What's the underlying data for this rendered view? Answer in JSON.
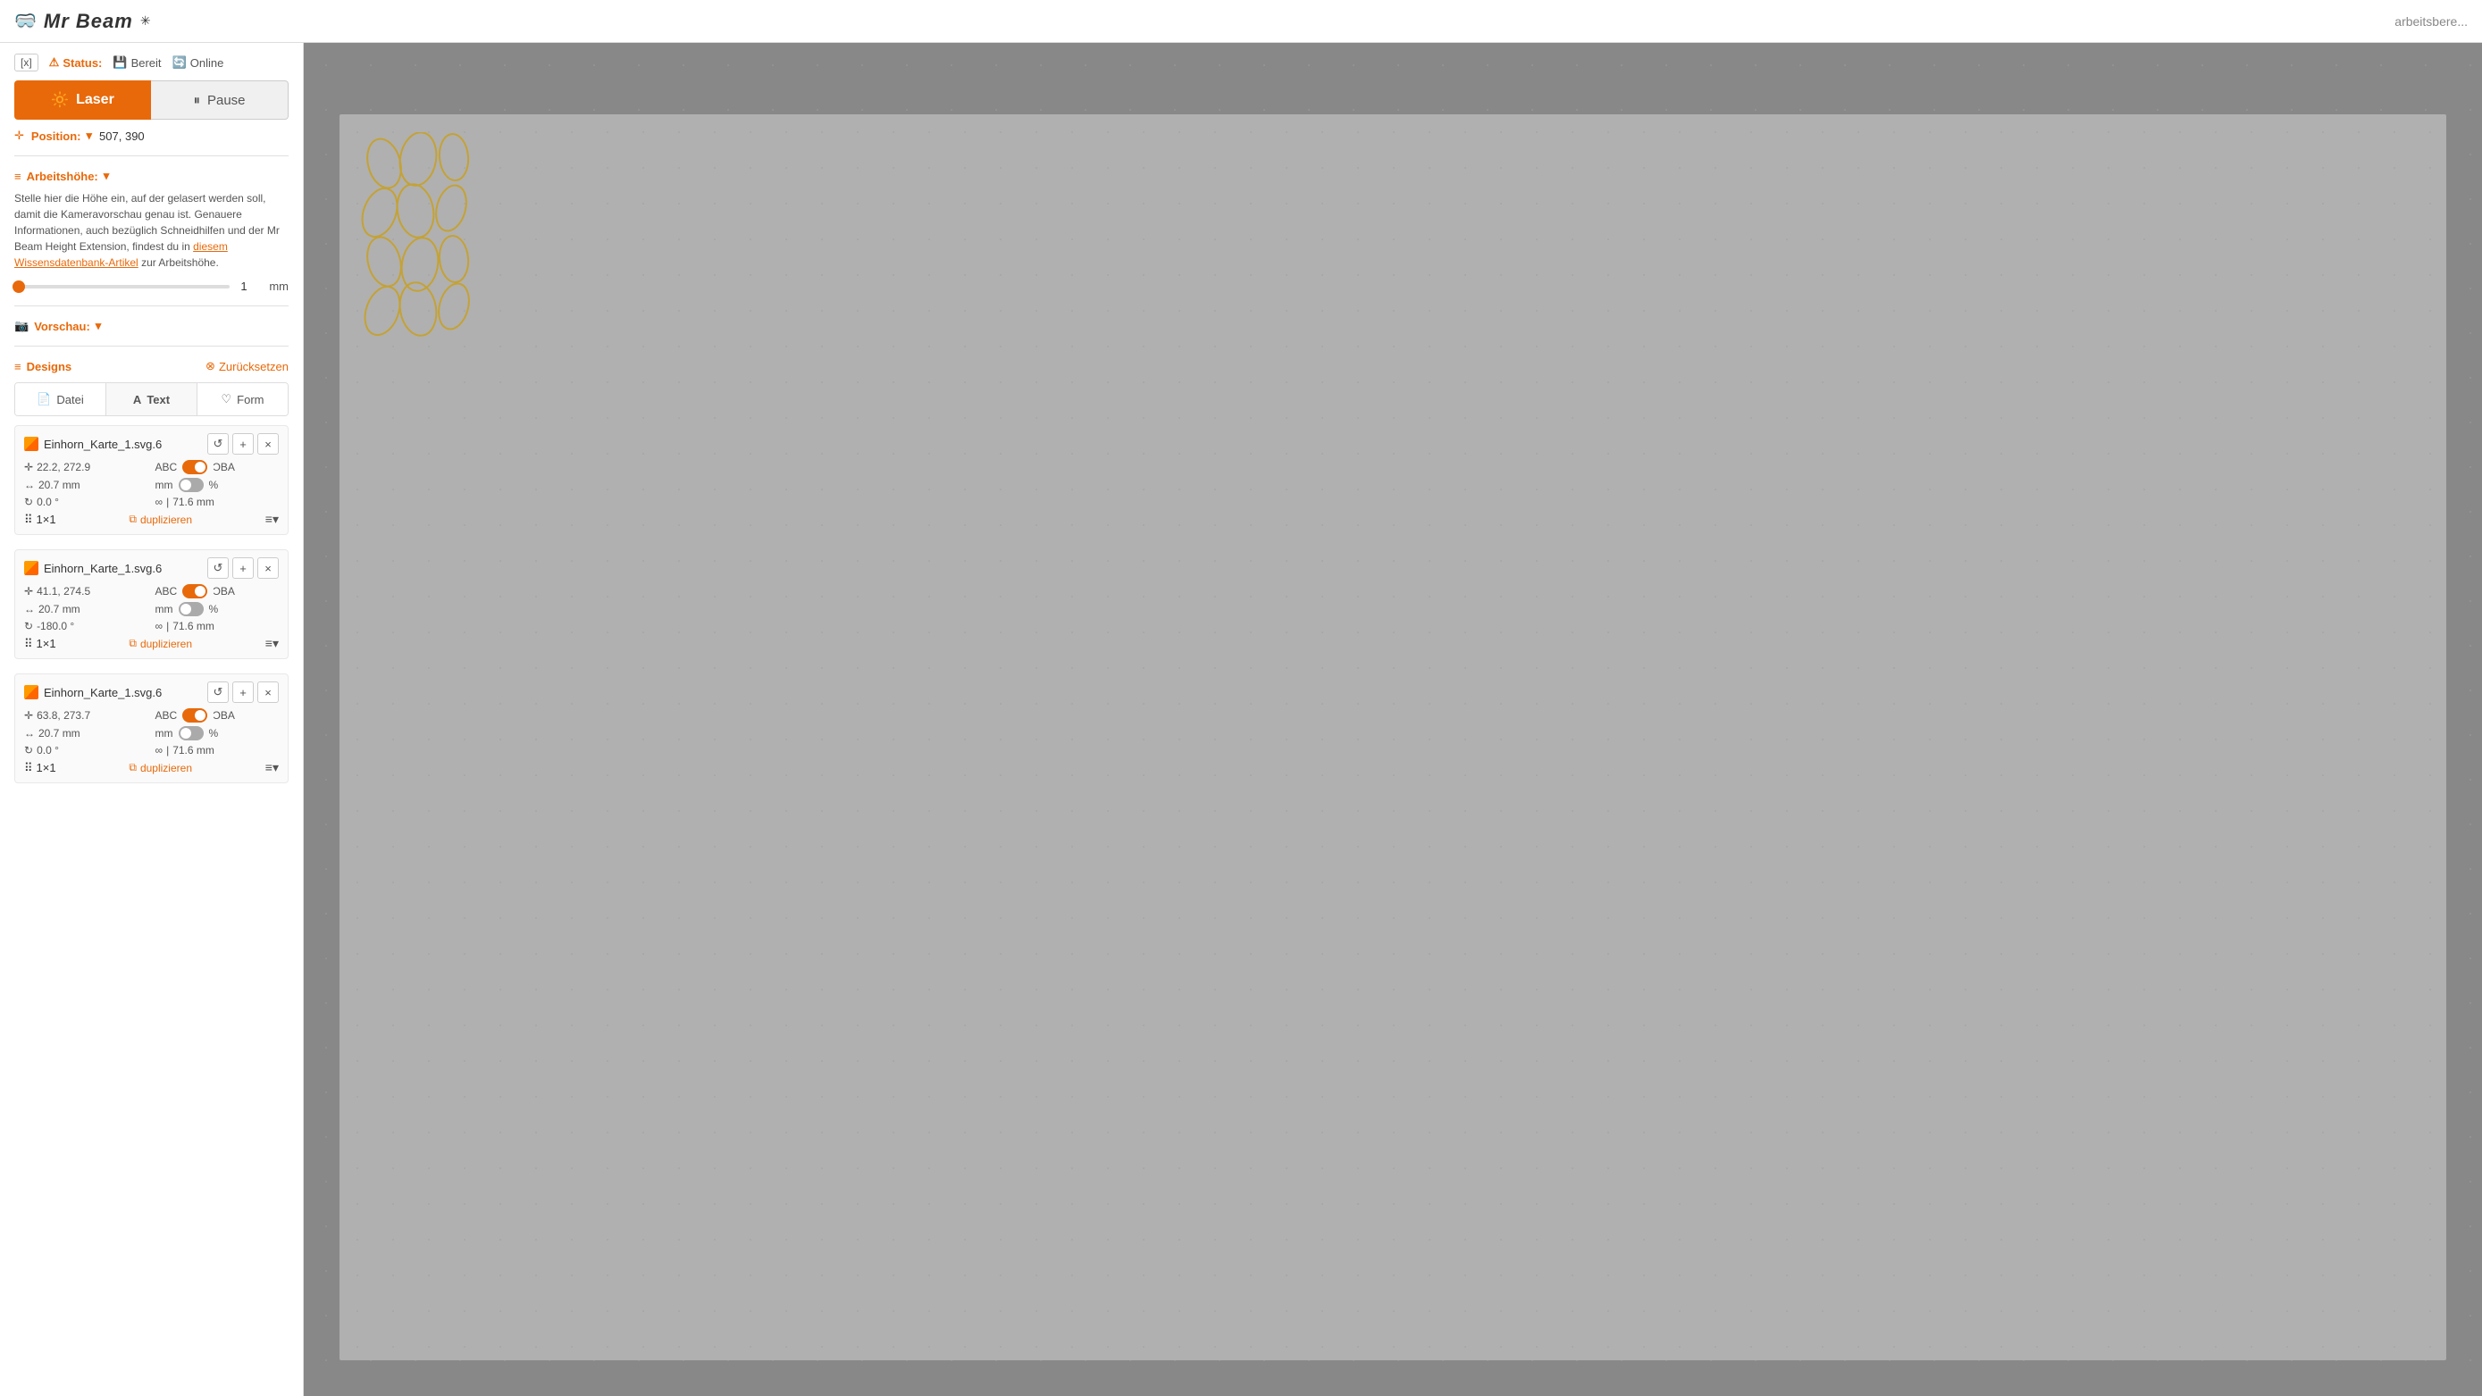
{
  "header": {
    "logo_text": "Mr Beam",
    "workspace_label": "arbeitsbere..."
  },
  "status": {
    "x_btn": "[x]",
    "label": "Status:",
    "ready": "Bereit",
    "online": "Online"
  },
  "buttons": {
    "laser": "Laser",
    "pause": "Pause"
  },
  "position": {
    "label": "Position:",
    "value": "507, 390"
  },
  "arbeit": {
    "label": "Arbeitshöhe:",
    "description": "Stelle hier die Höhe ein, auf der gelasert werden soll, damit die Kameravorschau genau ist. Genauere Informationen, auch bezüglich Schneidhilfen und der Mr Beam Height Extension, findest du in",
    "link_text": "diesem Wissensdatenbank-Artikel",
    "description_end": "zur Arbeitshöhe.",
    "slider_value": "1",
    "slider_unit": "mm"
  },
  "vorschau": {
    "label": "Vorschau:"
  },
  "designs": {
    "label": "Designs",
    "reset": "Zurücksetzen"
  },
  "tabs": [
    {
      "id": "datei",
      "label": "Datei",
      "icon": "📄"
    },
    {
      "id": "text",
      "label": "Text",
      "icon": "A"
    },
    {
      "id": "form",
      "label": "Form",
      "icon": "♡"
    }
  ],
  "design_items": [
    {
      "name": "Einhorn_Karte_1.svg.6",
      "position": "22.2, 272.9",
      "rotation": "0.0 °",
      "width": "20.7 mm",
      "height_linked": "71.6 mm",
      "grid": "1×1",
      "abc_label": "ABC",
      "abc_mirror": "ƆBA",
      "mm_label": "mm",
      "pct_label": "%",
      "duplicate": "duplizieren"
    },
    {
      "name": "Einhorn_Karte_1.svg.6",
      "position": "41.1, 274.5",
      "rotation": "-180.0 °",
      "width": "20.7 mm",
      "height_linked": "71.6 mm",
      "grid": "1×1",
      "abc_label": "ABC",
      "abc_mirror": "ƆBA",
      "mm_label": "mm",
      "pct_label": "%",
      "duplicate": "duplizieren"
    },
    {
      "name": "Einhorn_Karte_1.svg.6",
      "position": "63.8, 273.7",
      "rotation": "0.0 °",
      "width": "20.7 mm",
      "height_linked": "71.6 mm",
      "grid": "1×1",
      "abc_label": "ABC",
      "abc_mirror": "ƆBA",
      "mm_label": "mm",
      "pct_label": "%",
      "duplicate": "duplizieren"
    }
  ],
  "colors": {
    "accent": "#e8690a",
    "border": "#dddddd",
    "bg": "#f5f5f5"
  }
}
